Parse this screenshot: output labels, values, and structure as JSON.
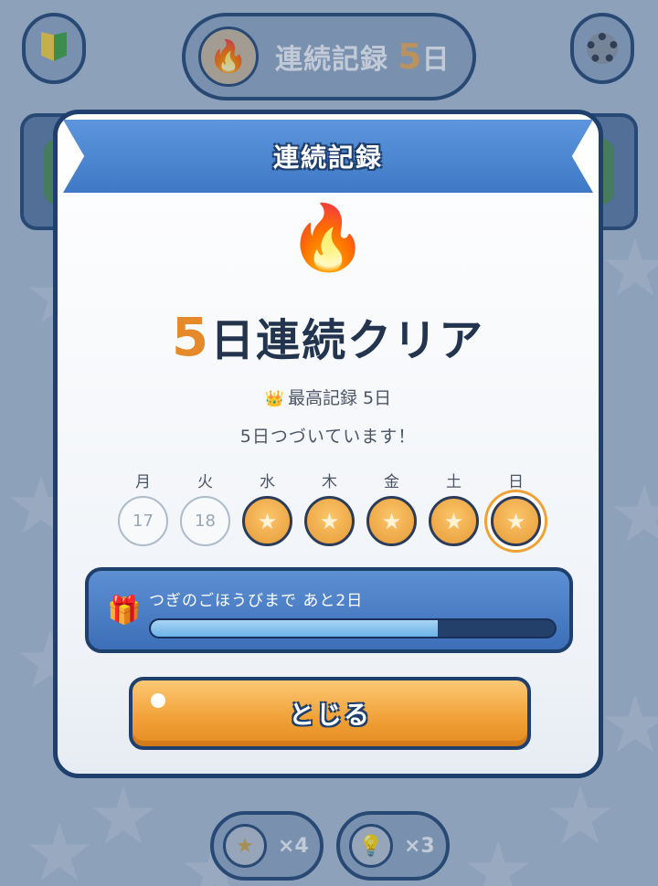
{
  "header": {
    "beginner_icon": "beginner-leaf-icon",
    "settings_icon": "gear-icon",
    "streak_icon": "flame-icon",
    "streak_label": "連続記録",
    "streak_count": "5",
    "streak_unit": "日"
  },
  "modal": {
    "title": "連続記録",
    "flame_emoji": "🔥",
    "headline_number": "5",
    "headline_text": "日連続クリア",
    "best_icon": "👑",
    "best_record": "最高記録 5日",
    "subtitle": "5日つづいています！",
    "days": [
      {
        "label": "月",
        "value": "17",
        "state": "missed"
      },
      {
        "label": "火",
        "value": "18",
        "state": "missed"
      },
      {
        "label": "水",
        "value": "★",
        "state": "cleared"
      },
      {
        "label": "木",
        "value": "★",
        "state": "cleared"
      },
      {
        "label": "金",
        "value": "★",
        "state": "cleared"
      },
      {
        "label": "土",
        "value": "★",
        "state": "cleared"
      },
      {
        "label": "日",
        "value": "★",
        "state": "today"
      }
    ],
    "reward": {
      "icon": "🎁",
      "text": "つぎのごほうびまで あと2日",
      "progress": 0.71
    },
    "close_label": "とじる"
  },
  "footer": {
    "hint_star_icon": "★",
    "hint_star_count": "×4",
    "hint_bulb_icon": "💡",
    "hint_bulb_count": "×3"
  },
  "colors": {
    "accent_orange": "#e48a2a",
    "ribbon_blue": "#4a84cf",
    "outline_navy": "#1f3f6d",
    "background": "#a9bcd3"
  }
}
